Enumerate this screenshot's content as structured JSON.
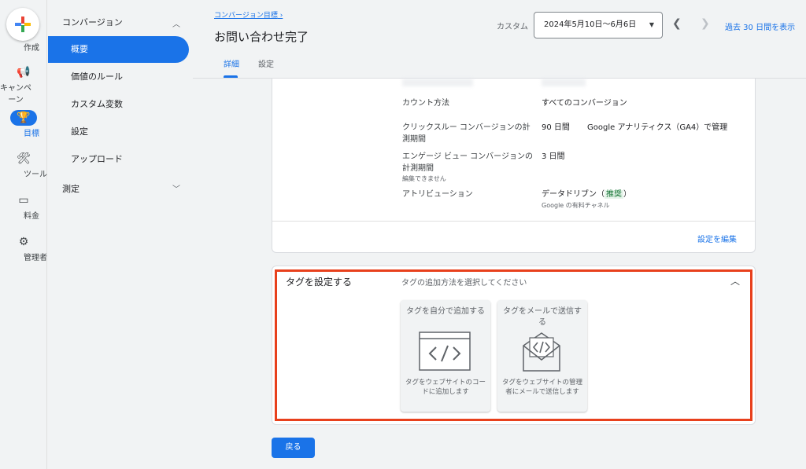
{
  "rail": {
    "create": "作成",
    "items": [
      {
        "icon": "megaphone-icon",
        "label": "キャンペーン"
      },
      {
        "icon": "trophy-icon",
        "label": "目標"
      },
      {
        "icon": "tools-icon",
        "label": "ツール"
      },
      {
        "icon": "billing-card-icon",
        "label": "料金"
      },
      {
        "icon": "gear-icon",
        "label": "管理者"
      }
    ]
  },
  "nav": {
    "group1": "コンバージョン",
    "items": [
      "概要",
      "価値のルール",
      "カスタム変数",
      "設定",
      "アップロード"
    ],
    "group2": "測定"
  },
  "header": {
    "breadcrumb": "コンバージョン目標",
    "title": "お問い合わせ完了",
    "tabs": [
      "詳細",
      "設定"
    ],
    "custom_label": "カスタム",
    "date_range": "2024年5月10日〜6月6日",
    "past_link": "過去 30 日間を表示"
  },
  "details": {
    "count_label": "カウント方法",
    "count_value": "すべてのコンバージョン",
    "click_label": "クリックスルー コンバージョンの計測期間",
    "click_value": "90 日間",
    "click_note": "Google アナリティクス（GA4）で管理",
    "engaged_label": "エンゲージ ビュー コンバージョンの計測期間",
    "engaged_sub": "編集できません",
    "engaged_value": "3 日間",
    "attr_label": "アトリビューション",
    "attr_value": "データドリブン（",
    "attr_chip": "推奨",
    "attr_close": "）",
    "attr_sub": "Google の有料チャネル",
    "edit_link": "設定を編集"
  },
  "tag": {
    "title": "タグを設定する",
    "hint": "タグの追加方法を選択してください",
    "option1_title": "タグを自分で追加する",
    "option1_desc": "タグをウェブサイトのコードに追加します",
    "option2_title": "タグをメールで送信する",
    "option2_desc": "タグをウェブサイトの管理者にメールで送信します"
  },
  "back_button": "戻る",
  "colors": {
    "accent": "#1a73e8",
    "highlight": "#e8401c"
  }
}
